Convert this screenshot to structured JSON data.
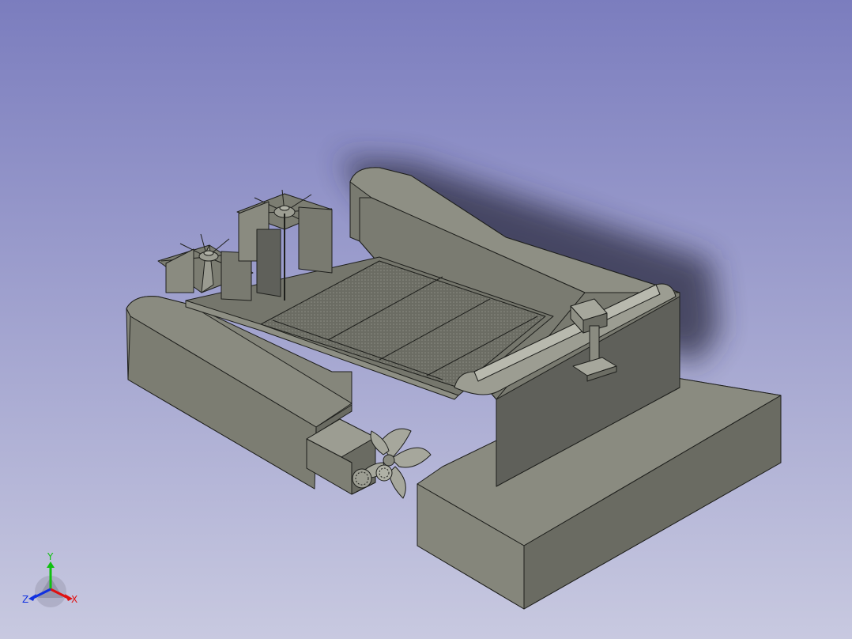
{
  "viewport": {
    "background_top": "#7b7dbe",
    "background_bottom": "#c8c9e0"
  },
  "model": {
    "body_colors": {
      "light": "#8a8b80",
      "mid": "#76776c",
      "dark": "#5f605a",
      "darker": "#4f504a",
      "edge": "#1e1f1c",
      "mesh": "#6e6f66"
    }
  },
  "axis_triad": {
    "x_label": "X",
    "y_label": "Y",
    "z_label": "Z",
    "x_color": "#e01010",
    "y_color": "#10c010",
    "z_color": "#1030e0"
  }
}
